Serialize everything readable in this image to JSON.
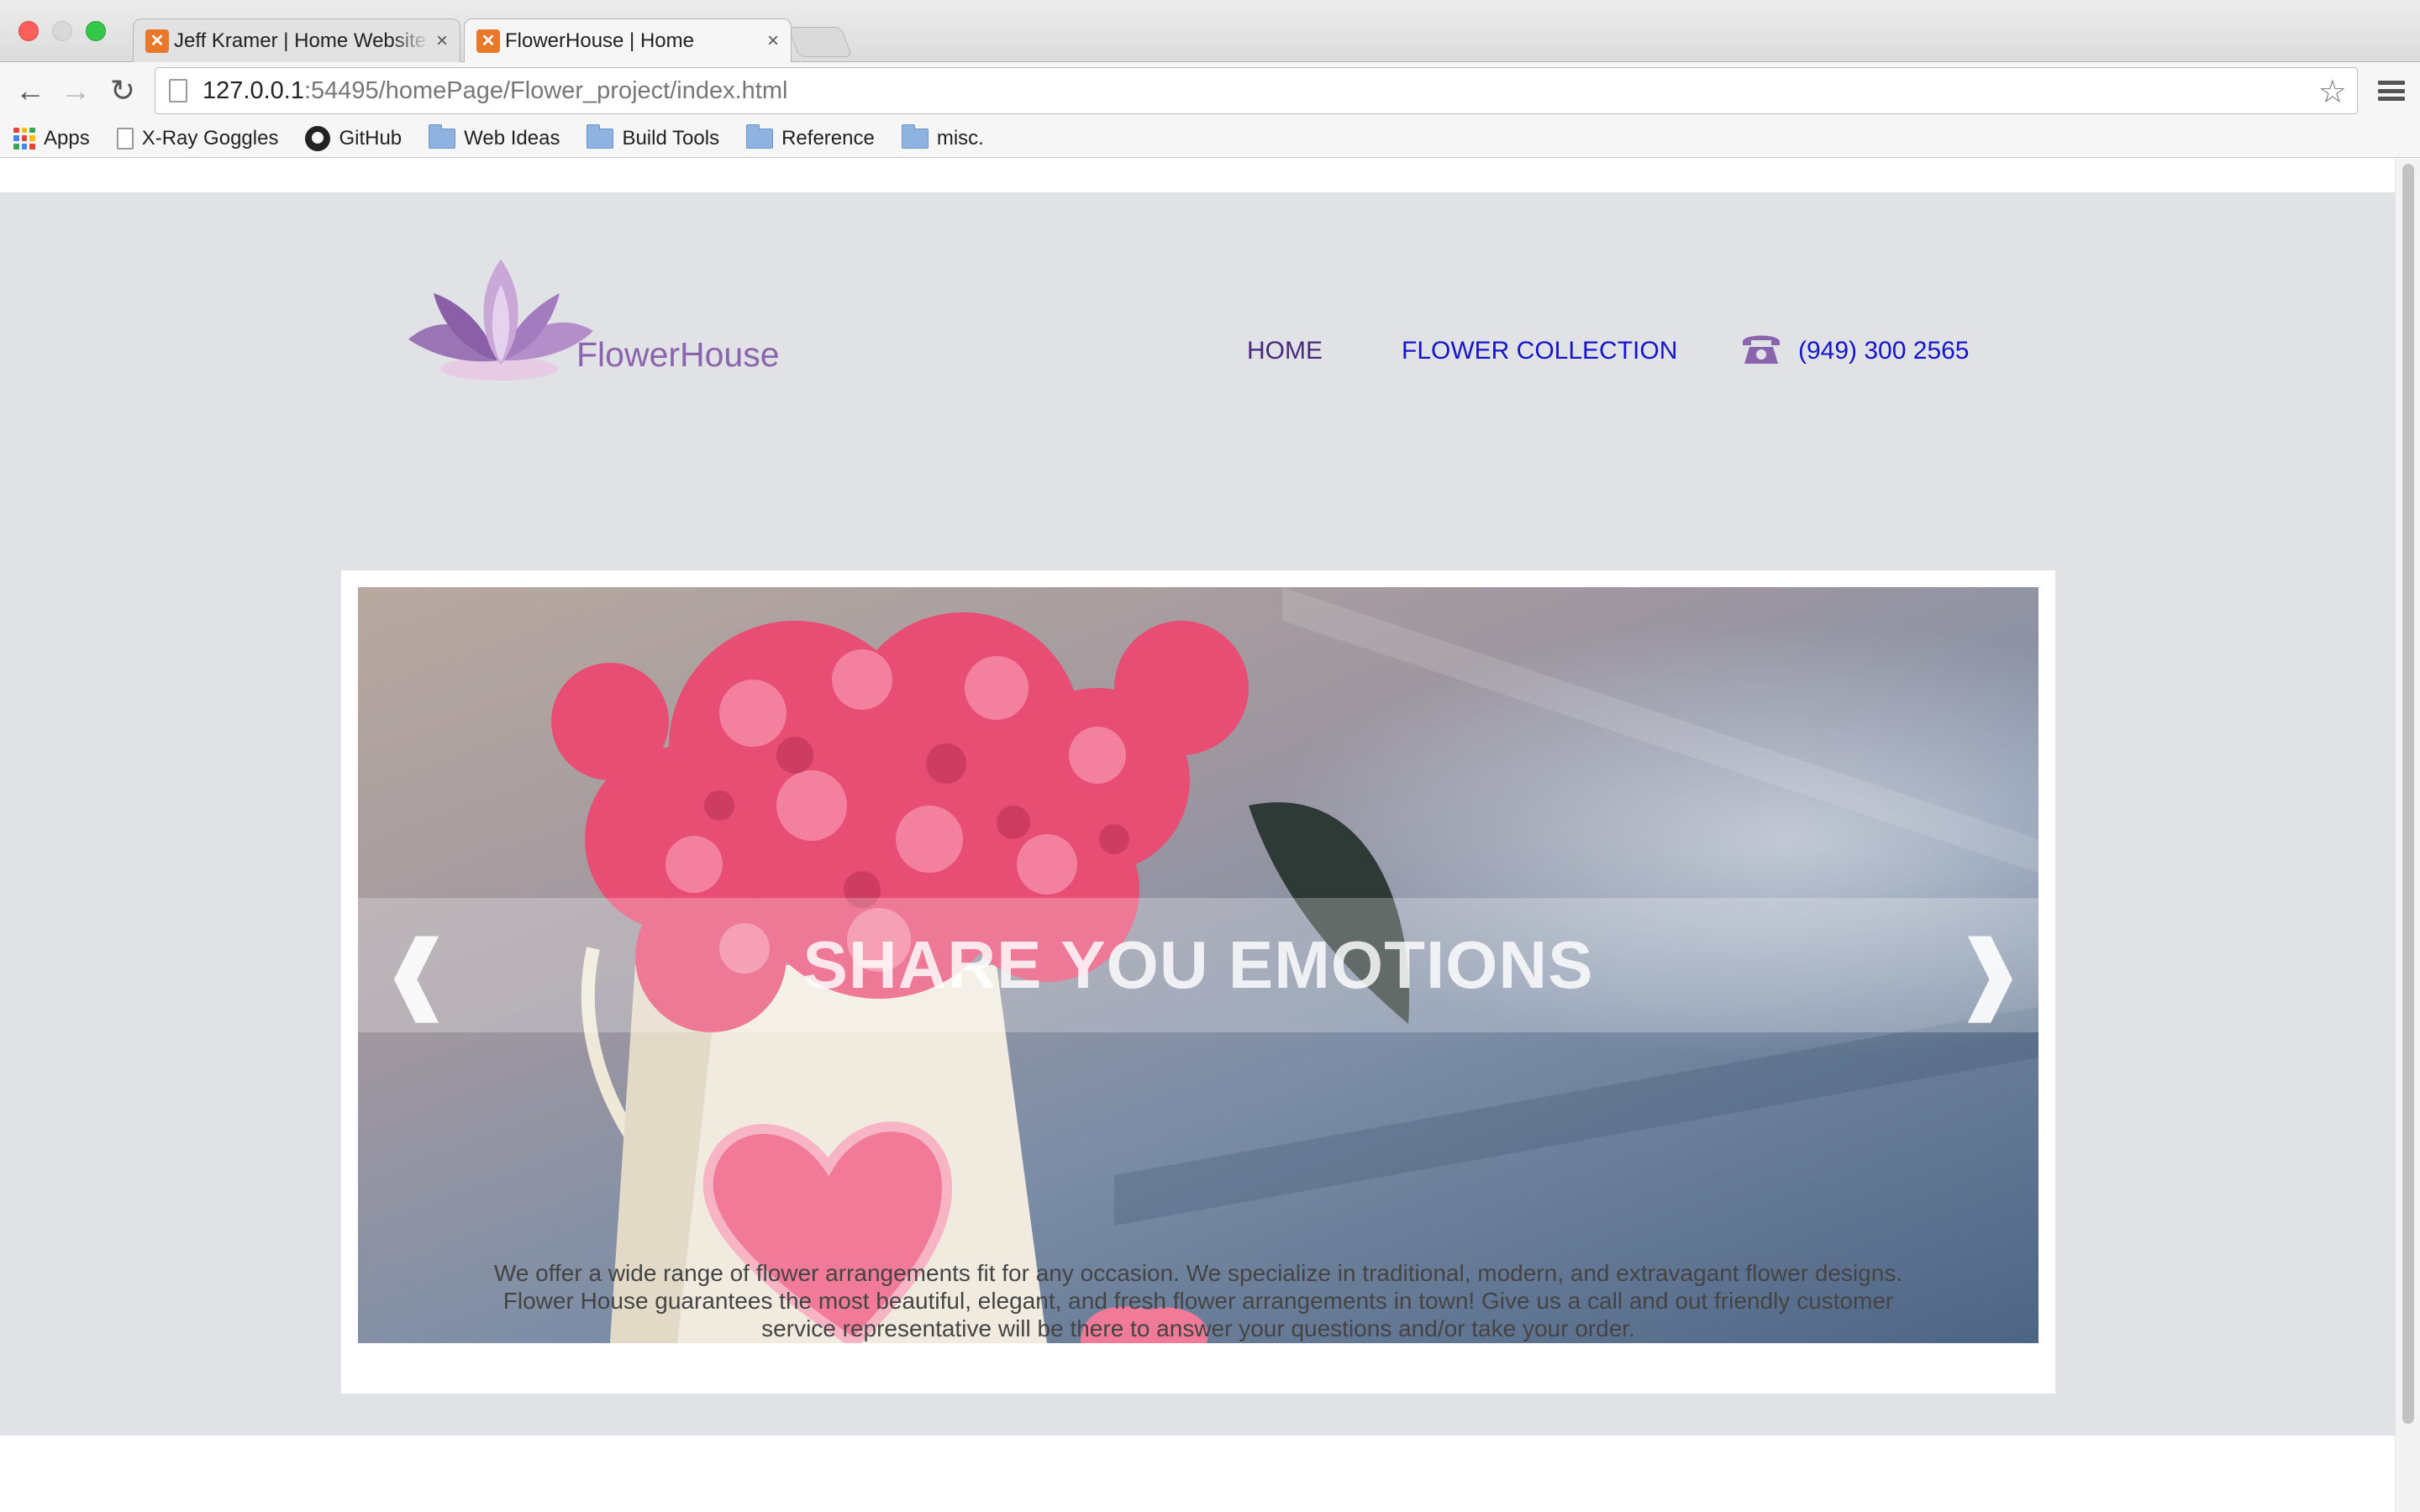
{
  "browser": {
    "tabs": [
      {
        "title": "Jeff Kramer | Home Website",
        "active": false
      },
      {
        "title": "FlowerHouse | Home",
        "active": true
      }
    ],
    "url_host": "127.0.0.1",
    "url_rest": ":54495/homePage/Flower_project/index.html",
    "bookmarks": [
      {
        "label": "Apps",
        "icon": "apps-grid-icon"
      },
      {
        "label": "X-Ray Goggles",
        "icon": "file-icon"
      },
      {
        "label": "GitHub",
        "icon": "github-icon"
      },
      {
        "label": "Web Ideas",
        "icon": "folder-icon"
      },
      {
        "label": "Build Tools",
        "icon": "folder-icon"
      },
      {
        "label": "Reference",
        "icon": "folder-icon"
      },
      {
        "label": "misc.",
        "icon": "folder-icon"
      }
    ]
  },
  "site": {
    "logo_text": "FlowerHouse",
    "nav": {
      "home": "HOME",
      "collection": "FLOWER COLLECTION",
      "phone": "(949) 300 2565"
    },
    "hero": {
      "caption": "SHARE YOU EMOTIONS",
      "prev": "❰",
      "next": "❱"
    },
    "intro": "We offer a wide range of flower arrangements fit for any occasion. We specialize in traditional, modern, and extravagant flower designs. Flower House guarantees the most beautiful, elegant, and fresh flower arrangements in town! Give us a call and out friendly customer service representative will be there to answer your questions and/or take your order."
  },
  "colors": {
    "brand_purple": "#8a64ad",
    "link_blue": "#1414c8",
    "link_visited": "#46297b",
    "page_bg": "#e1e2e5"
  }
}
